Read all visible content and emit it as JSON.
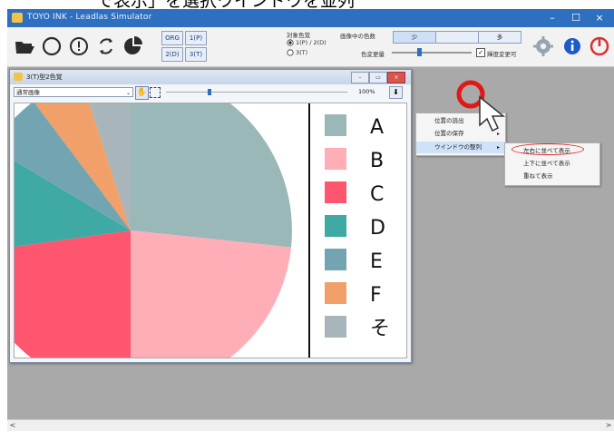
{
  "banner": {
    "text": "で表示」を選択ウインドウを並列"
  },
  "app": {
    "title": "TOYO INK - Leadlas Simulator",
    "minimize": "–",
    "maximize": "☐",
    "close": "×"
  },
  "toolbar": {
    "icons": [
      "folder-open-icon",
      "circle-icon",
      "alert-circle-icon",
      "refresh-icon",
      "pie-chart-icon"
    ],
    "buttons": [
      "ORG",
      "1(P)",
      "2(D)",
      "3(T)"
    ],
    "colormode_label": "対象色覚",
    "radio1": "1(P) / 2(D)",
    "radio2": "3(T)",
    "colorcount_label": "画像中の色数",
    "btn_few": "少",
    "btn_many": "多",
    "colorchange_label": "色変更量",
    "checkbox_label": "輝度変更可",
    "accent": "#2f6fc0"
  },
  "child": {
    "title": "3(T)型2色覚",
    "select": "通常画像",
    "zoom": "100%"
  },
  "chart_data": {
    "type": "pie",
    "categories": [
      "A",
      "B",
      "C",
      "D",
      "E",
      "F",
      "そ"
    ],
    "legend": [
      "A",
      "B",
      "C",
      "D",
      "E",
      "F",
      "そ"
    ],
    "colors": [
      "#9bb8b8",
      "#ffadb6",
      "#ff5670",
      "#3fa9a3",
      "#72a4b2",
      "#f0a068",
      "#a8b5ba"
    ],
    "legend_position": "right"
  },
  "menu1": {
    "items": [
      "位置の読出",
      "位置の保存",
      "ウインドウの整列"
    ]
  },
  "menu2": {
    "items": [
      "左右に並べて表示",
      "上下に並べて表示",
      "重ねて表示"
    ]
  },
  "scroll": {
    "left": "<",
    "right": ">"
  }
}
